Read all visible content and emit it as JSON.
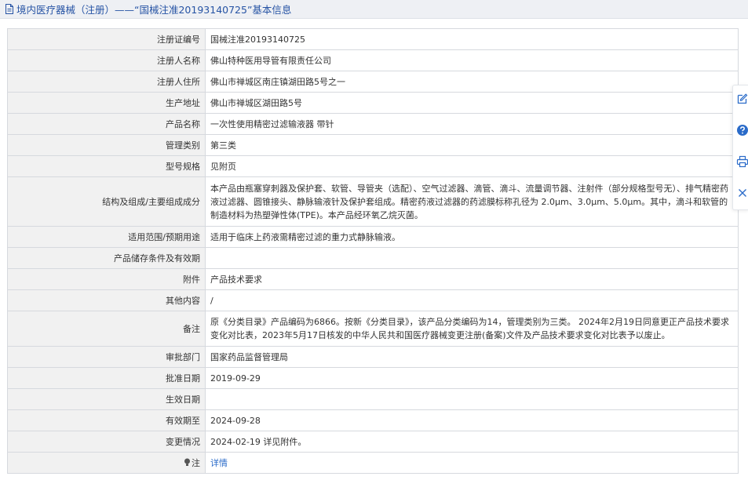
{
  "header": {
    "title": "境内医疗器械（注册）——“国械注准20193140725”基本信息"
  },
  "rows": [
    {
      "label": "注册证编号",
      "value": "国械注准20193140725"
    },
    {
      "label": "注册人名称",
      "value": "佛山特种医用导管有限责任公司"
    },
    {
      "label": "注册人住所",
      "value": "佛山市禅城区南庄镇湖田路5号之一"
    },
    {
      "label": "生产地址",
      "value": "佛山市禅城区湖田路5号"
    },
    {
      "label": "产品名称",
      "value": "一次性使用精密过滤输液器 带针"
    },
    {
      "label": "管理类别",
      "value": "第三类"
    },
    {
      "label": "型号规格",
      "value": "见附页"
    },
    {
      "label": "结构及组成/主要组成成分",
      "value": "本产品由瓶塞穿刺器及保护套、软管、导管夹（选配）、空气过滤器、滴管、滴斗、流量调节器、注射件（部分规格型号无）、排气精密药液过滤器、圆锥接头、静脉输液针及保护套组成。精密药液过滤器的药滤膜标称孔径为 2.0μm、3.0μm、5.0μm。其中，滴斗和软管的制造材料为热塑弹性体(TPE)。本产品经环氧乙烷灭菌。"
    },
    {
      "label": "适用范围/预期用途",
      "value": "适用于临床上药液需精密过滤的重力式静脉输液。"
    },
    {
      "label": "产品储存条件及有效期",
      "value": ""
    },
    {
      "label": "附件",
      "value": "产品技术要求"
    },
    {
      "label": "其他内容",
      "value": "/"
    },
    {
      "label": "备注",
      "value": "原《分类目录》产品编码为6866。按新《分类目录》，该产品分类编码为14，管理类别为三类。 2024年2月19日同意更正产品技术要求变化对比表，2023年5月17日核发的中华人民共和国医疗器械变更注册(备案)文件及产品技术要求变化对比表予以废止。"
    },
    {
      "label": "审批部门",
      "value": "国家药品监督管理局"
    },
    {
      "label": "批准日期",
      "value": "2019-09-29"
    },
    {
      "label": "生效日期",
      "value": ""
    },
    {
      "label": "有效期至",
      "value": "2024-09-28"
    },
    {
      "label": "变更情况",
      "value": "2024-02-19 详见附件。"
    }
  ],
  "note_row": {
    "label": "注",
    "link_text": "详情"
  },
  "toolbar": {
    "icons": [
      "edit-icon",
      "help-icon",
      "print-icon",
      "close-icon"
    ],
    "accent_color": "#2a6bc9"
  }
}
